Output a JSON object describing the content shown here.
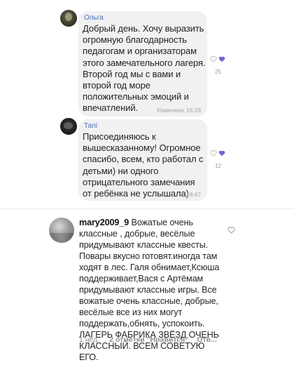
{
  "messages": [
    {
      "author": "Ольга",
      "text": "Добрый день. Хочу выразить огромную благодарность педагогам и организаторам этого замечательного лагеря. Второй год мы с вами и второй год море положительных эмоций и впечатлений.",
      "meta": "Изменено 16:28",
      "reaction_count": "25"
    },
    {
      "author": "Таni",
      "text": "Присоединяюсь к вышесказанному! Огромное спасибо, всем, кто работал с детьми) ни одного отрицательного замечания от ребёнка не услышала)",
      "meta": "18:47",
      "reaction_count": "12"
    }
  ],
  "comment": {
    "username": "mary2009_9",
    "text": "Вожатые очень классные , добрые, весёлые придумывают классные квесты. Повары вкусно готовят.иногда там ходят в лес. Галя обнимает,Ксюша поддерживает,Вася с Артёмам придумывают классные игры. Все вожатые очень классные, добрые, весёлые все из них могут поддержать,обнять, успокоить. ЛАГЕРЬ ФАБРИКА ЗВЁЗД ОЧЕНЬ КЛАССНЫЙ. ВСЕМ СОВЕТУЮ ЕГО.",
    "time": "1 нед.",
    "likes": "2 отметки \"Нравится\"",
    "reply": "Отв..."
  },
  "colors": {
    "author": "#4b6cb8",
    "reaction_heart": "#7b5fd6",
    "bubble": "#f1f1f3"
  },
  "icons": [
    "heart-outline-icon",
    "heart-filled-icon"
  ]
}
